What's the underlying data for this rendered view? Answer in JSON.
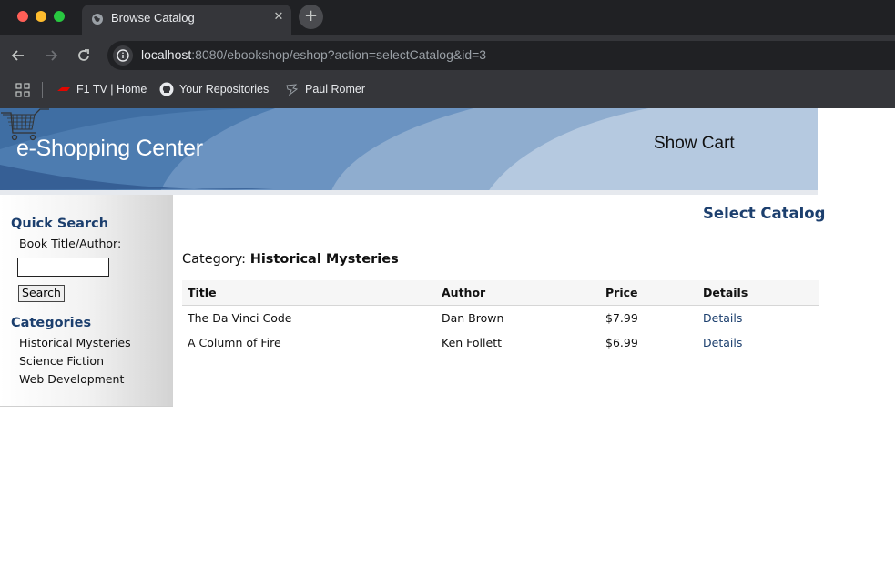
{
  "browser": {
    "tab_title": "Browse Catalog",
    "tab_close": "✕",
    "new_tab": "+",
    "url_host": "localhost",
    "url_path": ":8080/ebookshop/eshop?action=selectCatalog&id=3",
    "bookmarks": [
      {
        "label": "F1 TV | Home",
        "icon": "f1-icon"
      },
      {
        "label": "Your Repositories",
        "icon": "github-icon"
      },
      {
        "label": "Paul Romer",
        "icon": "bookmark-favicon-icon"
      }
    ]
  },
  "header": {
    "site_title": "e-Shopping Center",
    "show_cart": "Show Cart",
    "cart_icon": "shopping-cart-icon"
  },
  "sidebar": {
    "quick_search_heading": "Quick Search",
    "book_label": "Book Title/Author:",
    "search_value": "",
    "search_button": "Search",
    "categories_heading": "Categories",
    "categories": [
      "Historical Mysteries",
      "Science Fiction",
      "Web Development"
    ]
  },
  "main": {
    "heading": "Select Catalog",
    "category_label": "Category:",
    "category_name": "Historical Mysteries",
    "columns": [
      "Title",
      "Author",
      "Price",
      "Details"
    ],
    "rows": [
      {
        "title": "The Da Vinci Code",
        "author": "Dan Brown",
        "price": "$7.99",
        "details": "Details"
      },
      {
        "title": "A Column of Fire",
        "author": "Ken Follett",
        "price": "$6.99",
        "details": "Details"
      }
    ]
  },
  "colors": {
    "chrome_dark": "#202124",
    "chrome_mid": "#35363a",
    "banner_blue": "#4d7cb0",
    "heading_navy": "#1c3f6e",
    "link_navy": "#1c3f6e"
  }
}
